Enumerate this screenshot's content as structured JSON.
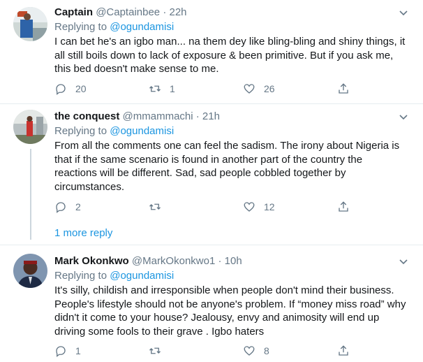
{
  "tweets": [
    {
      "name": "Captain",
      "handle": "@Captainbee",
      "time": "· 22h",
      "replying_prefix": "Replying to ",
      "replying_to": "@ogundamisi",
      "text_lines": [
        "I can bet he's an igbo man... na them dey like bling-bling and shiny things, it",
        "all still boils down to lack of exposure & been primitive. But if you ask me,",
        "this bed doesn't make sense to me."
      ],
      "replies": "20",
      "retweets": "1",
      "likes": "26"
    },
    {
      "name": "the conquest",
      "handle": "@mmammachi",
      "time": "· 21h",
      "replying_prefix": "Replying to ",
      "replying_to": "@ogundamisi",
      "text_lines": [
        "From all the comments one can feel the sadism. The irony about Nigeria is",
        "that if the same scenario is found in another part of the country the",
        "reactions will be different. Sad, sad people cobbled together by",
        "circumstances."
      ],
      "replies": "2",
      "retweets": "",
      "likes": "12"
    },
    {
      "name": "Mark Okonkwo",
      "handle": "@MarkOkonkwo1",
      "time": "· 10h",
      "replying_prefix": "Replying to ",
      "replying_to": "@ogundamisi",
      "text_lines": [
        "It's silly, childish and irresponsible when people don't mind their business.",
        "People's lifestyle should not be anyone's problem. If “money miss road” why",
        "didn't it come to your house? Jealousy, envy and animosity will end up",
        "driving some fools to their grave . Igbo haters"
      ],
      "replies": "1",
      "retweets": "",
      "likes": "8"
    }
  ],
  "more_reply": "1 more reply",
  "colors": {
    "link": "#1b95e0",
    "muted": "#657786",
    "text": "#14171a",
    "divider": "#e6ecf0"
  }
}
